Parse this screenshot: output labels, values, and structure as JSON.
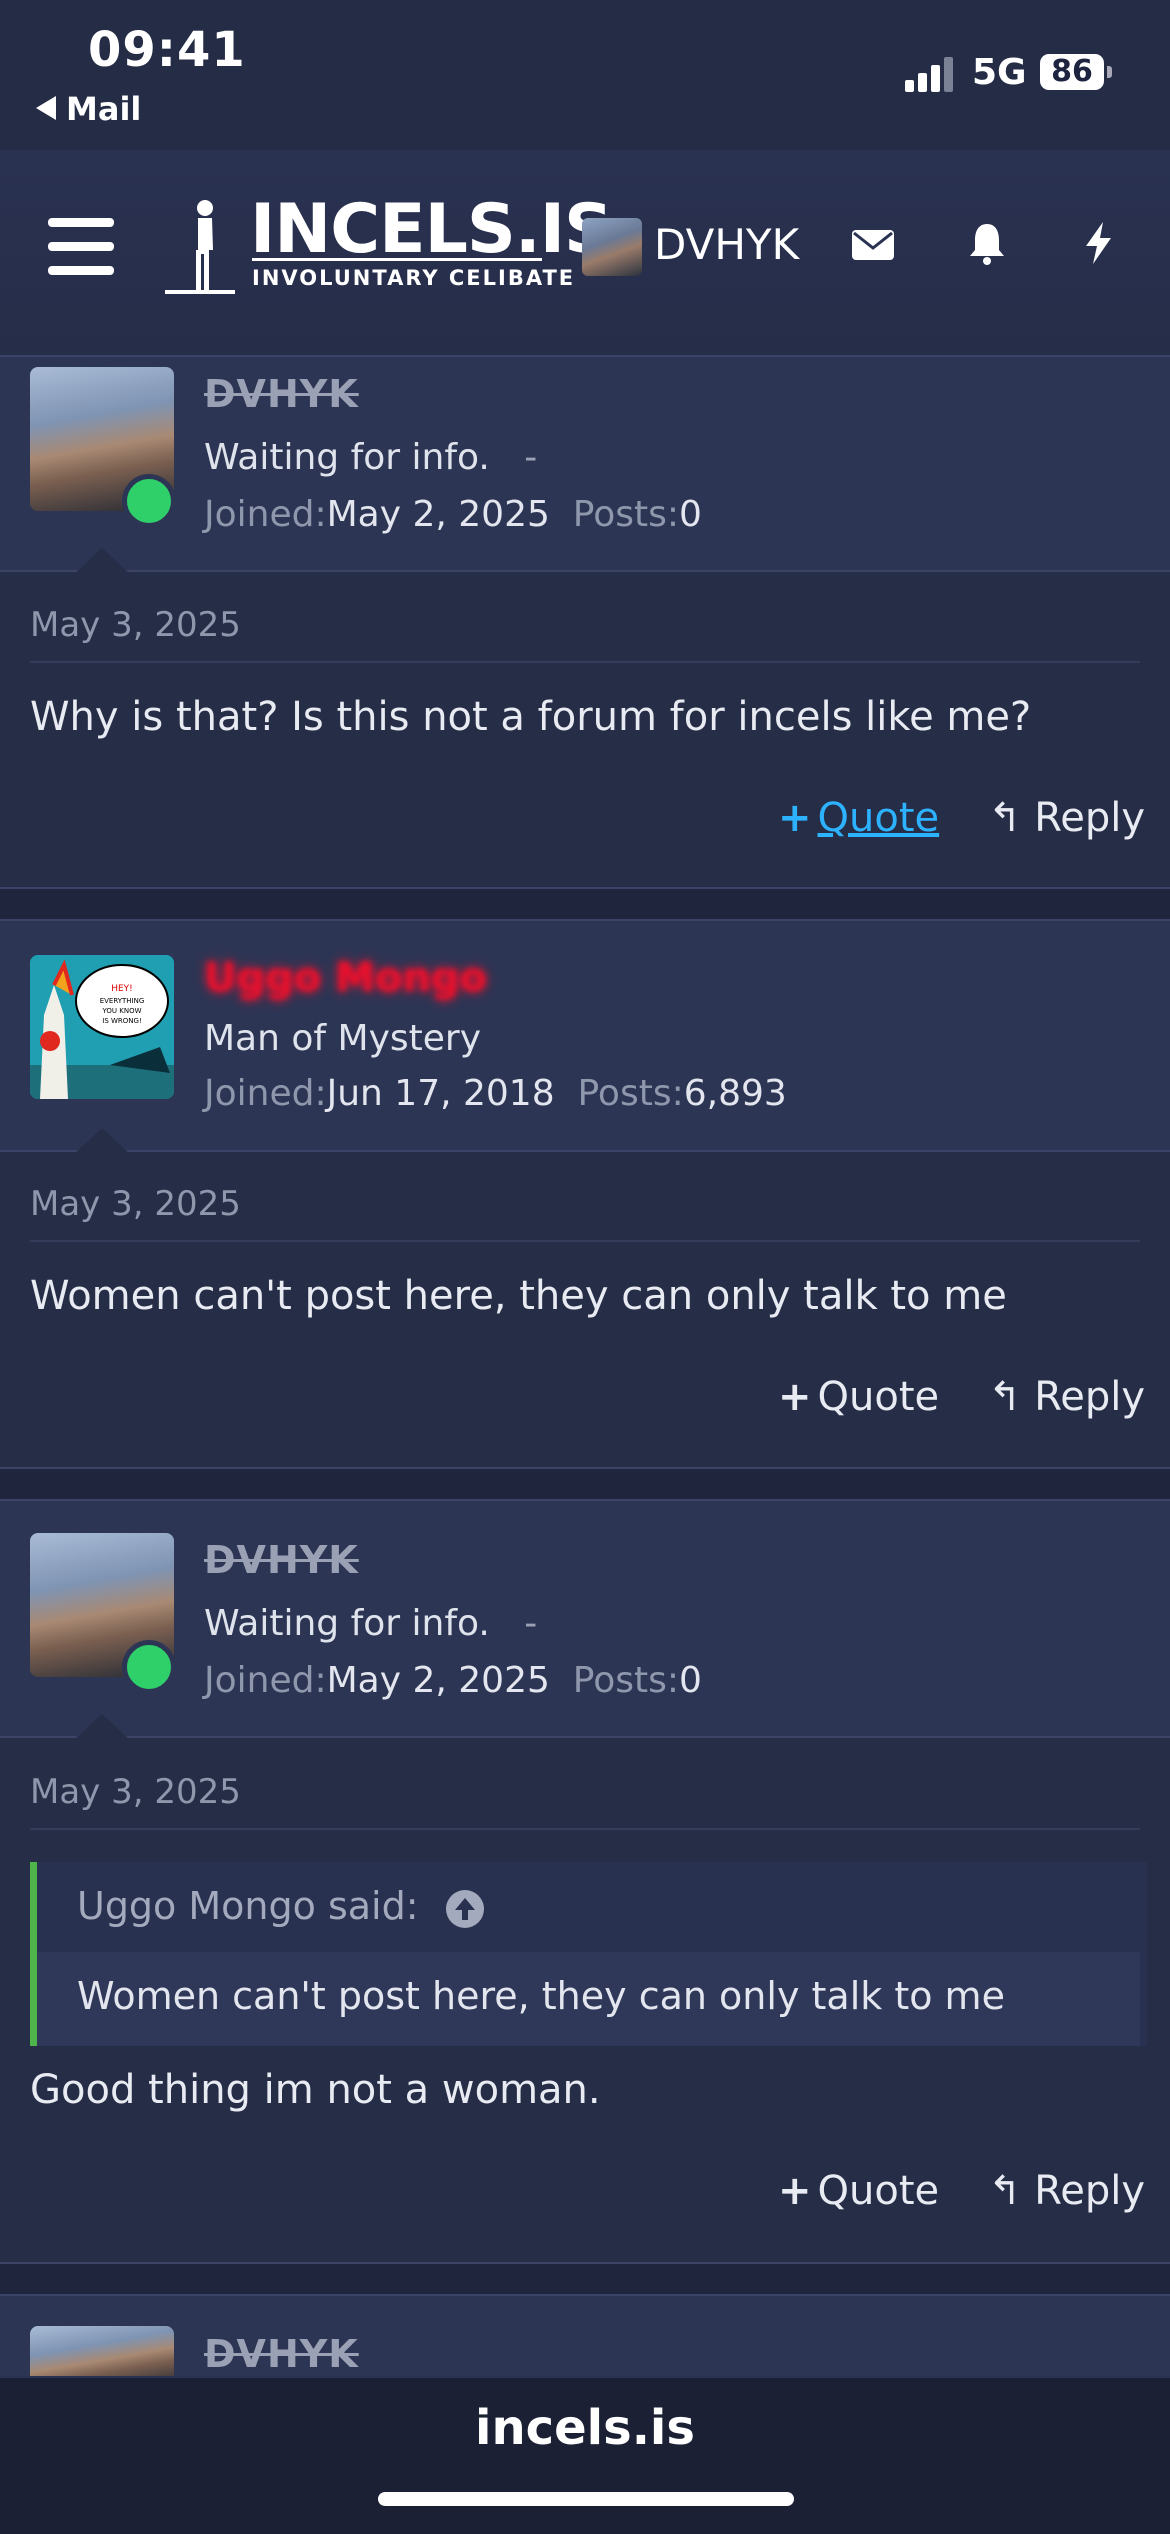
{
  "status_bar": {
    "time": "09:41",
    "back_label": "Mail",
    "network": "5G",
    "battery": "86"
  },
  "header": {
    "logo_title": "INCELS.IS",
    "logo_subtitle": "INVOLUNTARY CELIBATE",
    "username": "DVHYK"
  },
  "posts": [
    {
      "username": "DVHYK",
      "title": "Waiting for info.",
      "title_suffix": "-",
      "joined_label": "Joined:",
      "joined": "May 2, 2025",
      "posts_label": "Posts:",
      "posts": "0",
      "date": "May 3, 2025",
      "message": "Why is that? Is this not a forum for incels like me?",
      "quote_label": "Quote",
      "reply_label": "Reply"
    },
    {
      "username": "Uggo Mongo",
      "title": "Man of Mystery",
      "joined_label": "Joined:",
      "joined": "Jun 17, 2018",
      "posts_label": "Posts:",
      "posts": "6,893",
      "avatar_text": "HEY! EVERYTHING YOU KNOW IS WRONG!",
      "date": "May 3, 2025",
      "message": "Women can't post here, they can only talk to me",
      "quote_label": "Quote",
      "reply_label": "Reply"
    },
    {
      "username": "DVHYK",
      "title": "Waiting for info.",
      "title_suffix": "-",
      "joined_label": "Joined:",
      "joined": "May 2, 2025",
      "posts_label": "Posts:",
      "posts": "0",
      "date": "May 3, 2025",
      "quote_author": "Uggo Mongo said:",
      "quote_text": "Women can't post here, they can only talk to me",
      "message": "Good thing im not a woman.",
      "quote_label": "Quote",
      "reply_label": "Reply"
    },
    {
      "username": "DVHYK"
    }
  ],
  "browser": {
    "domain": "incels.is"
  },
  "colors": {
    "accent_link": "#2db2ff",
    "online": "#2fd06a",
    "quote_bar": "#4fb54a",
    "staff_name": "#e8112d"
  }
}
